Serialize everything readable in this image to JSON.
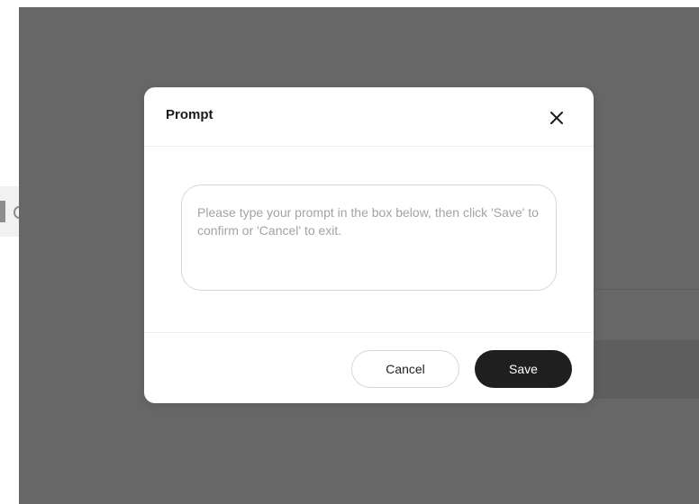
{
  "dialog": {
    "title": "Prompt",
    "close_icon": "close-icon",
    "prompt_placeholder": "Please type your prompt in the box below, then click 'Save' to confirm or 'Cancel' to exit.",
    "prompt_value": "",
    "cancel_label": "Cancel",
    "save_label": "Save"
  },
  "colors": {
    "overlay": "#676767",
    "save_button": "#1f1f1f",
    "dialog_background": "#ffffff"
  }
}
